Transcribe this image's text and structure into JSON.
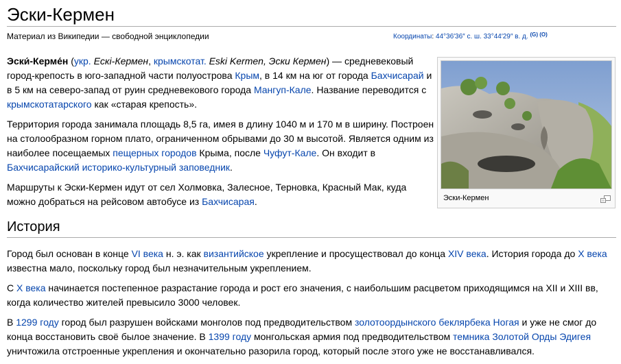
{
  "page": {
    "title": "Эски-Кермен",
    "site_sub": "Материал из Википедии — свободной энциклопедии"
  },
  "coords": {
    "label": "Координаты",
    "sep": ": ",
    "value": "44°36′36″ с. ш. 33°44′29″ в. д.",
    "sup1": "(G)",
    "sup2": "(O)"
  },
  "intro": {
    "p1": {
      "t1": "Эски́-Керме́н",
      "t2": " (",
      "l1": "укр.",
      "t3": " ",
      "i1": "Ескі-Кермен",
      "t4": ", ",
      "l2": "крымскотат.",
      "t5": " ",
      "i2": "Eski Kermen, Эски Кермен",
      "t6": ") — средневековый город-крепость в юго-западной части полуострова ",
      "l3": "Крым",
      "t7": ", в 14 км на юг от города ",
      "l4": "Бахчисарай",
      "t8": " и в 5 км на северо-запад от руин средневекового города ",
      "l5": "Мангуп-Кале",
      "t9": ". Название переводится с ",
      "l6": "крымскотатарского",
      "t10": " как «старая крепость»."
    },
    "p2": {
      "t1": "Территория города занимала площадь 8,5 га, имея в длину 1040 м и 170 м в ширину. Построен на столообразном горном плато, ограниченном обрывами до 30 м высотой. Является одним из наиболее посещаемых ",
      "l1": "пещерных городов",
      "t2": " Крыма, после ",
      "l2": "Чуфут-Кале",
      "t3": ". Он входит в ",
      "l3": "Бахчисарайский историко-культурный заповедник",
      "t4": "."
    },
    "p3": {
      "t1": "Маршруты к Эски-Кермен идут от сел Холмовка, Залесное, Терновка, Красный Мак, куда можно добраться на рейсовом автобусе из ",
      "l1": "Бахчисарая",
      "t2": "."
    }
  },
  "thumb": {
    "caption": "Эски-Кермен",
    "magnify_icon": "magnify-clip-icon"
  },
  "section": {
    "title": "История"
  },
  "history": {
    "p1": {
      "t1": "Город был основан в конце ",
      "l1": "VI века",
      "t2": " н. э. как ",
      "l2": "византийское",
      "t3": " укрепление и просуществовал до конца ",
      "l3": "XIV века",
      "t4": ". История города до ",
      "l4": "X века",
      "t5": " известна мало, поскольку город был незначительным укреплением."
    },
    "p2": {
      "t1": "С ",
      "l1": "X века",
      "t2": " начинается постепенное разрастание города и рост его значения, с наибольшим расцветом приходящимся на XII и XIII вв, когда количество жителей превысило 3000 человек."
    },
    "p3": {
      "t1": "В ",
      "l1": "1299 году",
      "t2": " город был разрушен войсками монголов под предводительством ",
      "l2": "золотоордынского беклярбека Ногая",
      "t3": " и уже не смог до конца восстановить своё былое значение. В ",
      "l3": "1399 году",
      "t4": " монгольская армия под предводительством ",
      "l4": "темника Золотой Орды Эдигея",
      "t5": " уничтожила отстроенные укрепления и окончательно разорила город, который после этого уже не восстанавливался."
    }
  },
  "colors": {
    "link": "#0645ad",
    "rule": "#aaaaaa",
    "thumb_border": "#cccccc"
  }
}
